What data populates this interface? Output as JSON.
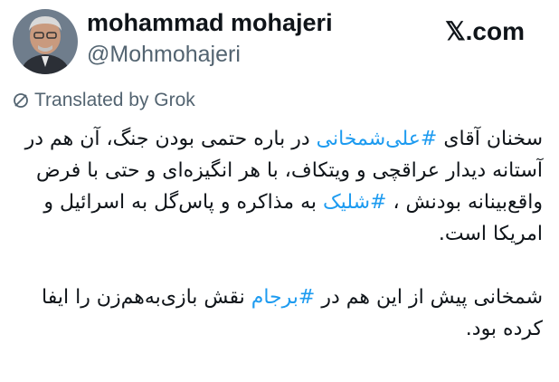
{
  "author": {
    "name": "mohammad mohajeri",
    "handle": "@Mohmohajeri"
  },
  "brand": "𝕏.com",
  "translated_label": "Translated by Grok",
  "icons": {
    "translate": "translate-icon",
    "avatar": "profile-photo"
  },
  "colors": {
    "hashtag": "#1d9bf0",
    "text": "#0f1419",
    "muted": "#536471"
  },
  "body": {
    "p1": {
      "t1": "سخنان آقای ",
      "h1": "#علی‌شمخانی",
      "t2": " در باره حتمی بودن جنگ، آن هم در آستانه دیدار عراقچی و ویتکاف، با هر انگیزه‌ای و حتی با فرض  واقع‌بینانه بودنش ، ",
      "h2": "#شلیک",
      "t3": " به مذاکره و پاس‌گل به اسرائیل و امریکا است."
    },
    "p2": {
      "t1": "شمخانی پیش از این هم در ",
      "h1": "#برجام",
      "t2": " نقش بازی‌به‌هم‌زن را ایفا کرده بود."
    }
  }
}
